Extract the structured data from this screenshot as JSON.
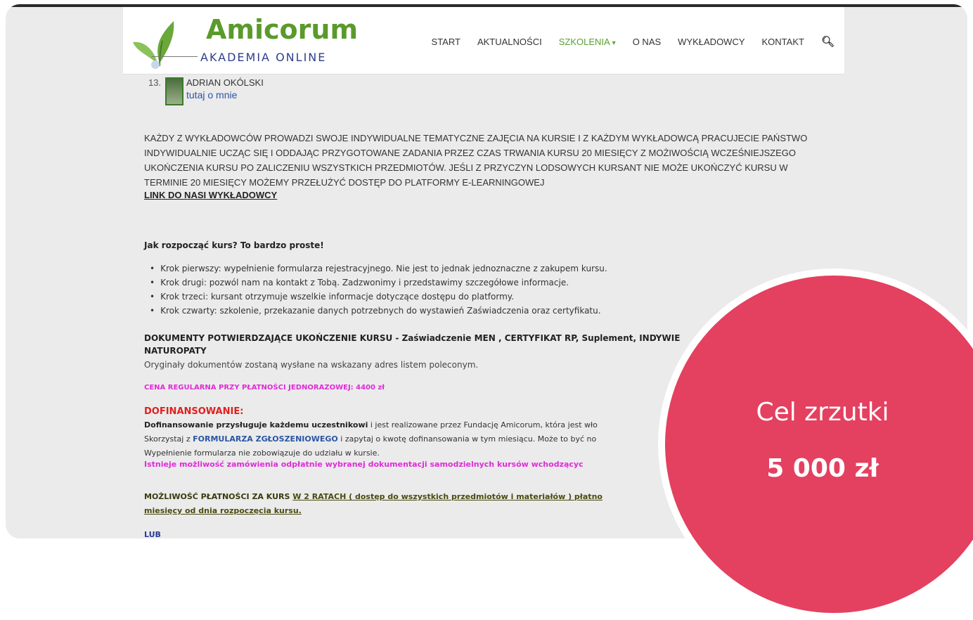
{
  "header": {
    "brand": "Amicorum",
    "tagline": "AKADEMIA ONLINE",
    "nav": [
      "START",
      "AKTUALNOŚCI",
      "SZKOLENIA",
      "O NAS",
      "WYKŁADOWCY",
      "KONTAKT"
    ],
    "active_index": 2
  },
  "lecturer": {
    "number": "13.",
    "name": "ADRIAN OKÓLSKI",
    "link": "tutaj o mnie"
  },
  "content": {
    "intro": "KAŻDY Z WYKŁADOWCÓW PROWADZI SWOJE INDYWIDUALNE TEMATYCZNE ZAJĘCIA NA KURSIE I Z KAŻDYM WYKŁADOWCĄ PRACUJECIE PAŃSTWO INDYWIDUALNIE UCZĄC SIĘ I ODDAJĄC PRZYGOTOWANE ZADANIA PRZEZ CZAS TRWANIA KURSU 20 MIESIĘCY Z MOŻIWOŚCIĄ WCZEŚNIEJSZEGO UKOŃCZENIA KURSU PO ZALICZENIU WSZYSTKICH PRZEDMIOTÓW. JEŚLI Z PRZYCZYN LODSOWYCH KURSANT NIE MOŻE UKOŃCZYĆ KURSU W TERMINIE 20 MIESIĘCY MOŻEMY PRZEŁUŻYĆ DOSTĘP DO PLATFORMY E-LEARNINGOWEJ",
    "lecturers_link": "LINK DO NASI WYKŁADOWCY",
    "how_heading": "Jak rozpocząć kurs? To bardzo proste!",
    "steps": [
      "Krok pierwszy: wypełnienie formularza rejestracyjnego. Nie jest to jednak jednoznaczne z zakupem kursu.",
      "Krok drugi: pozwól nam na kontakt z Tobą. Zadzwonimy i przedstawimy szczegółowe informacje.",
      "Krok trzeci: kursant otrzymuje wszelkie informacje dotyczące dostępu do platformy.",
      "Krok czwarty: szkolenie, przekazanie danych potrzebnych do wystawień Zaświadczenia oraz certyfikatu."
    ],
    "docs_heading": "DOKUMENTY POTWIERDZAJĄCE UKOŃCZENIE KURSU - Zaświadczenie MEN  , CERTYFIKAT RP, Suplement, INDYWIE",
    "docs_heading_2": "NATUROPATY",
    "docs_note": "Oryginały dokumentów zostaną wysłane na wskazany adres listem poleconym.",
    "price": "CENA REGULARNA PRZY PŁATNOŚCI  JEDNORAZOWEJ: 4400 zł",
    "funding_heading": "DOFINANSOWANIE:",
    "funding_bold": "Dofinansowanie przysługuje każdemu uczestnikowi",
    "funding_rest": " i jest realizowane przez Fundację Amicorum, która jest wło",
    "funding_2_a": "Skorzystaj z ",
    "funding_form": "FORMULARZA ZGŁOSZENIOWEGO",
    "funding_2_b": " i zapytaj o kwotę dofinansowania w tym miesiącu. Może to być no",
    "funding_3": "Wypełnienie formularza nie zobowiązuje do udziału w kursie.",
    "funding_4": "Istnieje możliwość zamówienia odpłatnie wybranej dokumentacji samodzielnych kursów wchodzącyc",
    "payment_a": "MOŻLIWOŚĆ PŁATNOŚCI ZA KURS ",
    "payment_u": "W  2 RATACH  ( dostęp do wszystkich przedmiotów i materiałów ) płatno",
    "payment_2": "miesięcy od dnia rozpoczęcia kursu.",
    "lub": "LUB"
  },
  "goal": {
    "title": "Cel zrzutki",
    "value": "5 000 zł",
    "color": "#e4405f"
  }
}
